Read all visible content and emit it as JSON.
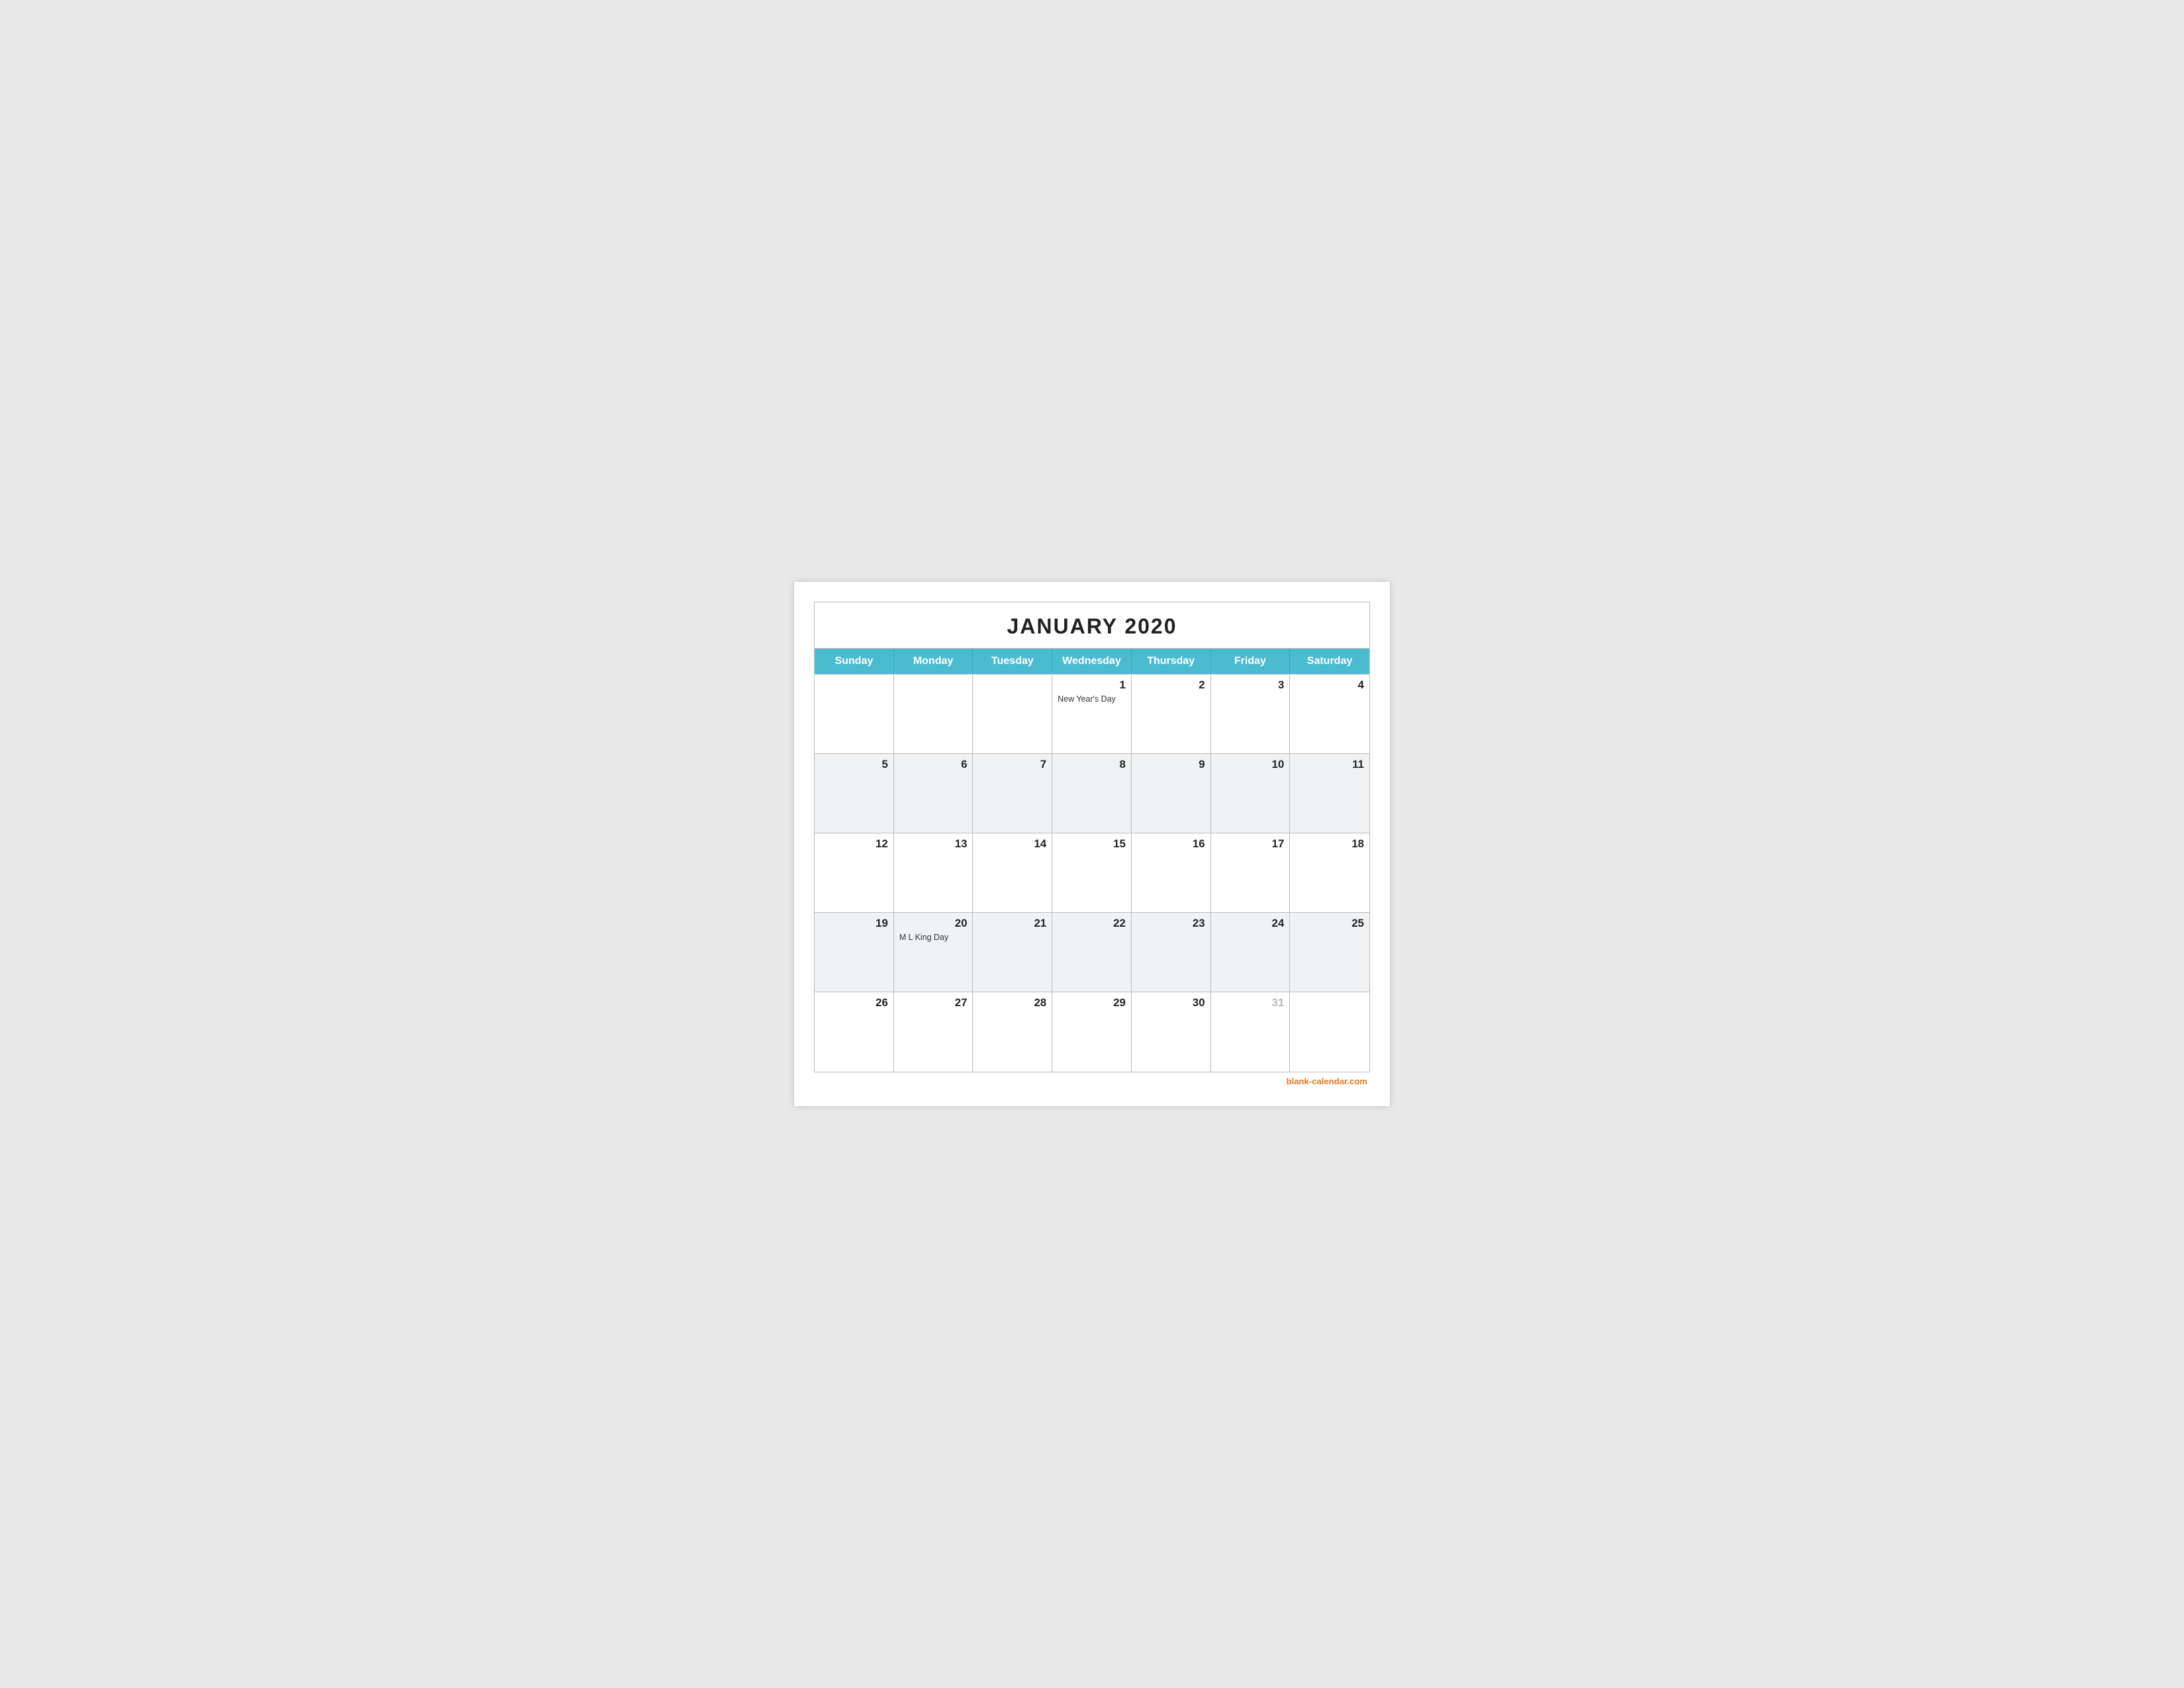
{
  "calendar": {
    "title": "JANUARY 2020",
    "header_days": [
      "Sunday",
      "Monday",
      "Tuesday",
      "Wednesday",
      "Thursday",
      "Friday",
      "Saturday"
    ],
    "weeks": [
      [
        {
          "day": "",
          "shaded": false,
          "event": ""
        },
        {
          "day": "",
          "shaded": false,
          "event": ""
        },
        {
          "day": "",
          "shaded": false,
          "event": ""
        },
        {
          "day": "1",
          "shaded": false,
          "event": "New Year's Day"
        },
        {
          "day": "2",
          "shaded": false,
          "event": ""
        },
        {
          "day": "3",
          "shaded": false,
          "event": ""
        },
        {
          "day": "4",
          "shaded": false,
          "event": ""
        }
      ],
      [
        {
          "day": "5",
          "shaded": true,
          "event": ""
        },
        {
          "day": "6",
          "shaded": true,
          "event": ""
        },
        {
          "day": "7",
          "shaded": true,
          "event": ""
        },
        {
          "day": "8",
          "shaded": true,
          "event": ""
        },
        {
          "day": "9",
          "shaded": true,
          "event": ""
        },
        {
          "day": "10",
          "shaded": true,
          "event": ""
        },
        {
          "day": "11",
          "shaded": true,
          "event": ""
        }
      ],
      [
        {
          "day": "12",
          "shaded": false,
          "event": ""
        },
        {
          "day": "13",
          "shaded": false,
          "event": ""
        },
        {
          "day": "14",
          "shaded": false,
          "event": ""
        },
        {
          "day": "15",
          "shaded": false,
          "event": ""
        },
        {
          "day": "16",
          "shaded": false,
          "event": ""
        },
        {
          "day": "17",
          "shaded": false,
          "event": ""
        },
        {
          "day": "18",
          "shaded": false,
          "event": ""
        }
      ],
      [
        {
          "day": "19",
          "shaded": true,
          "event": ""
        },
        {
          "day": "20",
          "shaded": true,
          "event": "M L King Day"
        },
        {
          "day": "21",
          "shaded": true,
          "event": ""
        },
        {
          "day": "22",
          "shaded": true,
          "event": ""
        },
        {
          "day": "23",
          "shaded": true,
          "event": ""
        },
        {
          "day": "24",
          "shaded": true,
          "event": ""
        },
        {
          "day": "25",
          "shaded": true,
          "event": ""
        }
      ],
      [
        {
          "day": "26",
          "shaded": false,
          "event": ""
        },
        {
          "day": "27",
          "shaded": false,
          "event": ""
        },
        {
          "day": "28",
          "shaded": false,
          "event": ""
        },
        {
          "day": "29",
          "shaded": false,
          "event": ""
        },
        {
          "day": "30",
          "shaded": false,
          "event": ""
        },
        {
          "day": "31",
          "shaded": false,
          "greyed": true,
          "event": ""
        },
        {
          "day": "",
          "shaded": false,
          "event": ""
        }
      ]
    ],
    "footer_link": "blank-calendar.com"
  }
}
